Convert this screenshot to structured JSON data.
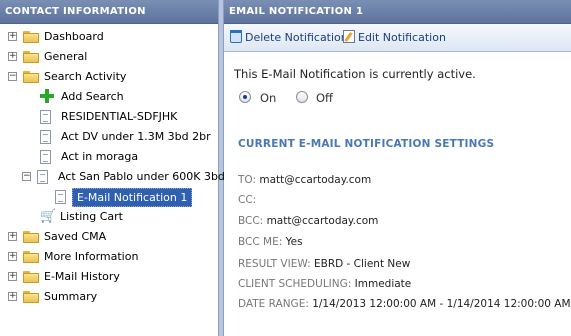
{
  "left_panel": {
    "title": "CONTACT INFORMATION"
  },
  "right_panel": {
    "title": "EMAIL NOTIFICATION 1"
  },
  "tree": {
    "dashboard": "Dashboard",
    "general": "General",
    "search_activity": "Search Activity",
    "add_search": "Add Search",
    "item_residential": "RESIDENTIAL-SDFJHK",
    "item_act_dv": "Act DV under 1.3M 3bd 2br",
    "item_act_moraga": "Act in moraga",
    "item_act_san_pablo": "Act San Pablo under 600K 3bd",
    "item_email_notification": "E-Mail Notification 1",
    "listing_cart": "Listing Cart",
    "saved_cma": "Saved CMA",
    "more_information": "More Information",
    "email_history": "E-Mail History",
    "summary": "Summary",
    "expand_glyph": "+",
    "collapse_glyph": "−"
  },
  "toolbar": {
    "delete_label": "Delete Notification",
    "edit_label": "Edit Notification"
  },
  "content": {
    "status_text": "This E-Mail Notification is currently active.",
    "radio_on": "On",
    "radio_off": "Off",
    "radio_selected": "On",
    "section_title": "CURRENT E-MAIL NOTIFICATION SETTINGS",
    "to_label": "TO:",
    "to_value": "matt@ccartoday.com",
    "cc_label": "CC:",
    "cc_value": "",
    "bcc_label": "BCC:",
    "bcc_value": "matt@ccartoday.com",
    "bcc_me_label": "BCC ME:",
    "bcc_me_value": "Yes",
    "result_view_label": "RESULT VIEW:",
    "result_view_value": "EBRD - Client New",
    "client_scheduling_label": "CLIENT SCHEDULING:",
    "client_scheduling_value": "Immediate",
    "date_range_label": "DATE RANGE:",
    "date_range_value": "1/14/2013 12:00:00 AM - 1/14/2014 12:00:00 AM"
  },
  "icons": [
    "folder-icon",
    "document-icon",
    "add-icon",
    "cart-icon",
    "trash-icon",
    "edit-icon"
  ],
  "colors": {
    "header": "#6a7fa8",
    "selection": "#2f5fb0",
    "section_title": "#4a78b5"
  }
}
